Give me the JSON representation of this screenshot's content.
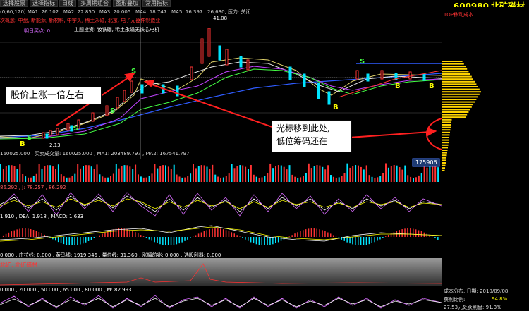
{
  "toolbar": {
    "items": [
      "选择股票",
      "选择指标",
      "日线",
      "多周期组合",
      "图形叠加",
      "常用指标"
    ]
  },
  "title": {
    "code": "600980",
    "name": "北矿磁材"
  },
  "main_pane": {
    "ma_line": "(0,60,120)  MA1: 26.102 , MA2: 22.850 , MA3: 20.005 , MA4: 18.747 , MA5: 16.397 , 26,630, 压力: 关闭",
    "concept_line": "次概念: 中盘, 新能源, 新材料, 中字头, 稀土永磁, 北京, 电子元器件制造业",
    "main_topic": "主题投资: 钕铁硼, 稀土永磁无铁芯电机",
    "tomorrow_label": "明日买点: 0",
    "high_price": "41.08",
    "low_price": "2.13"
  },
  "annotations": {
    "callout1": "股价上涨一倍左右",
    "callout2_line1": "光标移到此处,",
    "callout2_line2": "低位筹码还在"
  },
  "volume_pane": {
    "line": "160025.000 , 买卖成交量: 160025.000 , MA1: 203489.797 , MA2: 167541.797",
    "last_value": "175906"
  },
  "kdj_pane": {
    "line": "86.292 , J: 78.257 , 86.292"
  },
  "macd_pane": {
    "line": "1.910 , DEA: 1.918 , MACD: 1.633"
  },
  "bottom_pane": {
    "line": "0.000 , 庄拉线: 0.000 , 黄马线: 1919.346 , 量价线: 31.360 , 涨幅前兆: 0.000 , 选股利器: 0.000",
    "stock_label": "北矿: 北矿磁材"
  },
  "bottom_last": {
    "line": "0.000 , 20.000 , 50.000 , 65.000 , 80.000 , M: 82.993"
  },
  "right_panel": {
    "header": "TOP移动成本",
    "dist_title": "成本分布, 日期: 2010/09/08",
    "profit_label": "获利比例:",
    "profit_value": "94.8%",
    "detail": "27.53元处获利盘: 91.3%"
  },
  "colors": {
    "accent_red": "#ff3333",
    "accent_green": "#00e676",
    "yellow": "#ffff00",
    "cyan": "#00e5ff",
    "purple": "#d86bff"
  }
}
